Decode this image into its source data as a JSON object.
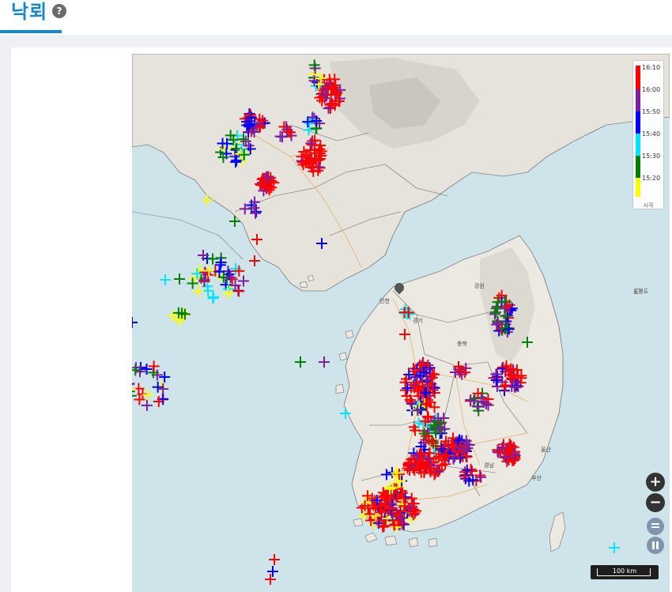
{
  "header": {
    "title": "낙뢰",
    "help_icon_glyph": "?"
  },
  "legend": {
    "ticks": [
      "16:10",
      "16:00",
      "15:50",
      "15:40",
      "15:30",
      "15:20"
    ],
    "caption": "시각",
    "colors": [
      "#ff0000",
      "#7b1fa2",
      "#0000ff",
      "#00e5ff",
      "#008000",
      "#ffff00"
    ]
  },
  "map": {
    "place_labels": {
      "ulleungdo": "울릉도",
      "incheon": "인천",
      "gyeonggi": "경기",
      "gangwon": "강원",
      "chungbuk": "충북",
      "gyeongnam": "경남",
      "ulsan": "울산",
      "busan": "부산"
    },
    "scale": {
      "label": "100 km"
    },
    "controls": {
      "zoom_in": "+",
      "zoom_out": "−"
    }
  },
  "lightning_strike_colors": {
    "16:10": "#ff0000",
    "16:00": "#7b1fa2",
    "15:50": "#0000ff",
    "15:40": "#00e5ff",
    "15:30": "#008000",
    "15:20": "#ffff00"
  }
}
